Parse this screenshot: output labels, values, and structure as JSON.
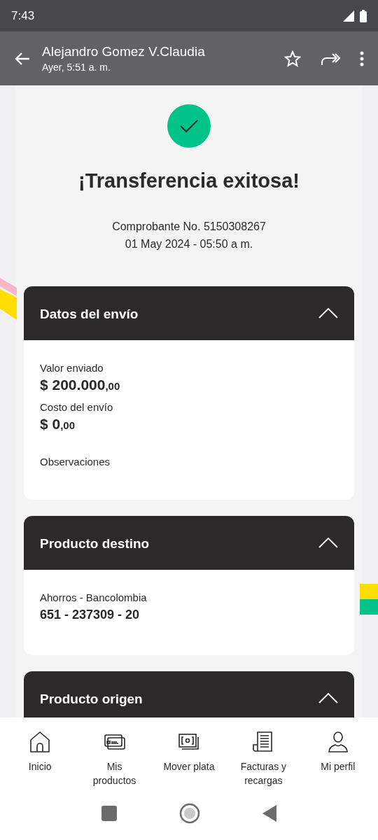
{
  "status_bar": {
    "time": "7:43"
  },
  "chat_header": {
    "title": "Alejandro Gomez V.Claudia",
    "subtitle": "Ayer, 5:51 a. m."
  },
  "receipt": {
    "title": "¡Transferencia exitosa!",
    "lines": [
      "Comprobante No. 5150308267",
      "01 May 2024 - 05:50 a m."
    ]
  },
  "sections": [
    {
      "title": "Datos del envío",
      "expanded": true,
      "fields": [
        {
          "kind": "amount",
          "label": "Valor enviado",
          "value": "$ 200.000",
          "cents": ",00"
        },
        {
          "kind": "amount",
          "label": "Costo del envío",
          "value": "$ 0",
          "cents": ",00"
        },
        {
          "kind": "label",
          "label": "Observaciones"
        }
      ]
    },
    {
      "title": "Producto destino",
      "expanded": true,
      "fields": [
        {
          "kind": "account",
          "label": "Ahorros - Bancolombia",
          "value": "651 - 237309 - 20"
        }
      ]
    },
    {
      "title": "Producto origen",
      "expanded": true
    }
  ],
  "bottom_nav": [
    {
      "kind": "home",
      "label": "Inicio"
    },
    {
      "kind": "cards",
      "label": "Mis productos"
    },
    {
      "kind": "money",
      "label": "Mover plata"
    },
    {
      "kind": "receipt",
      "label": "Facturas y recargas"
    },
    {
      "kind": "person",
      "label": "Mi perfil"
    }
  ]
}
